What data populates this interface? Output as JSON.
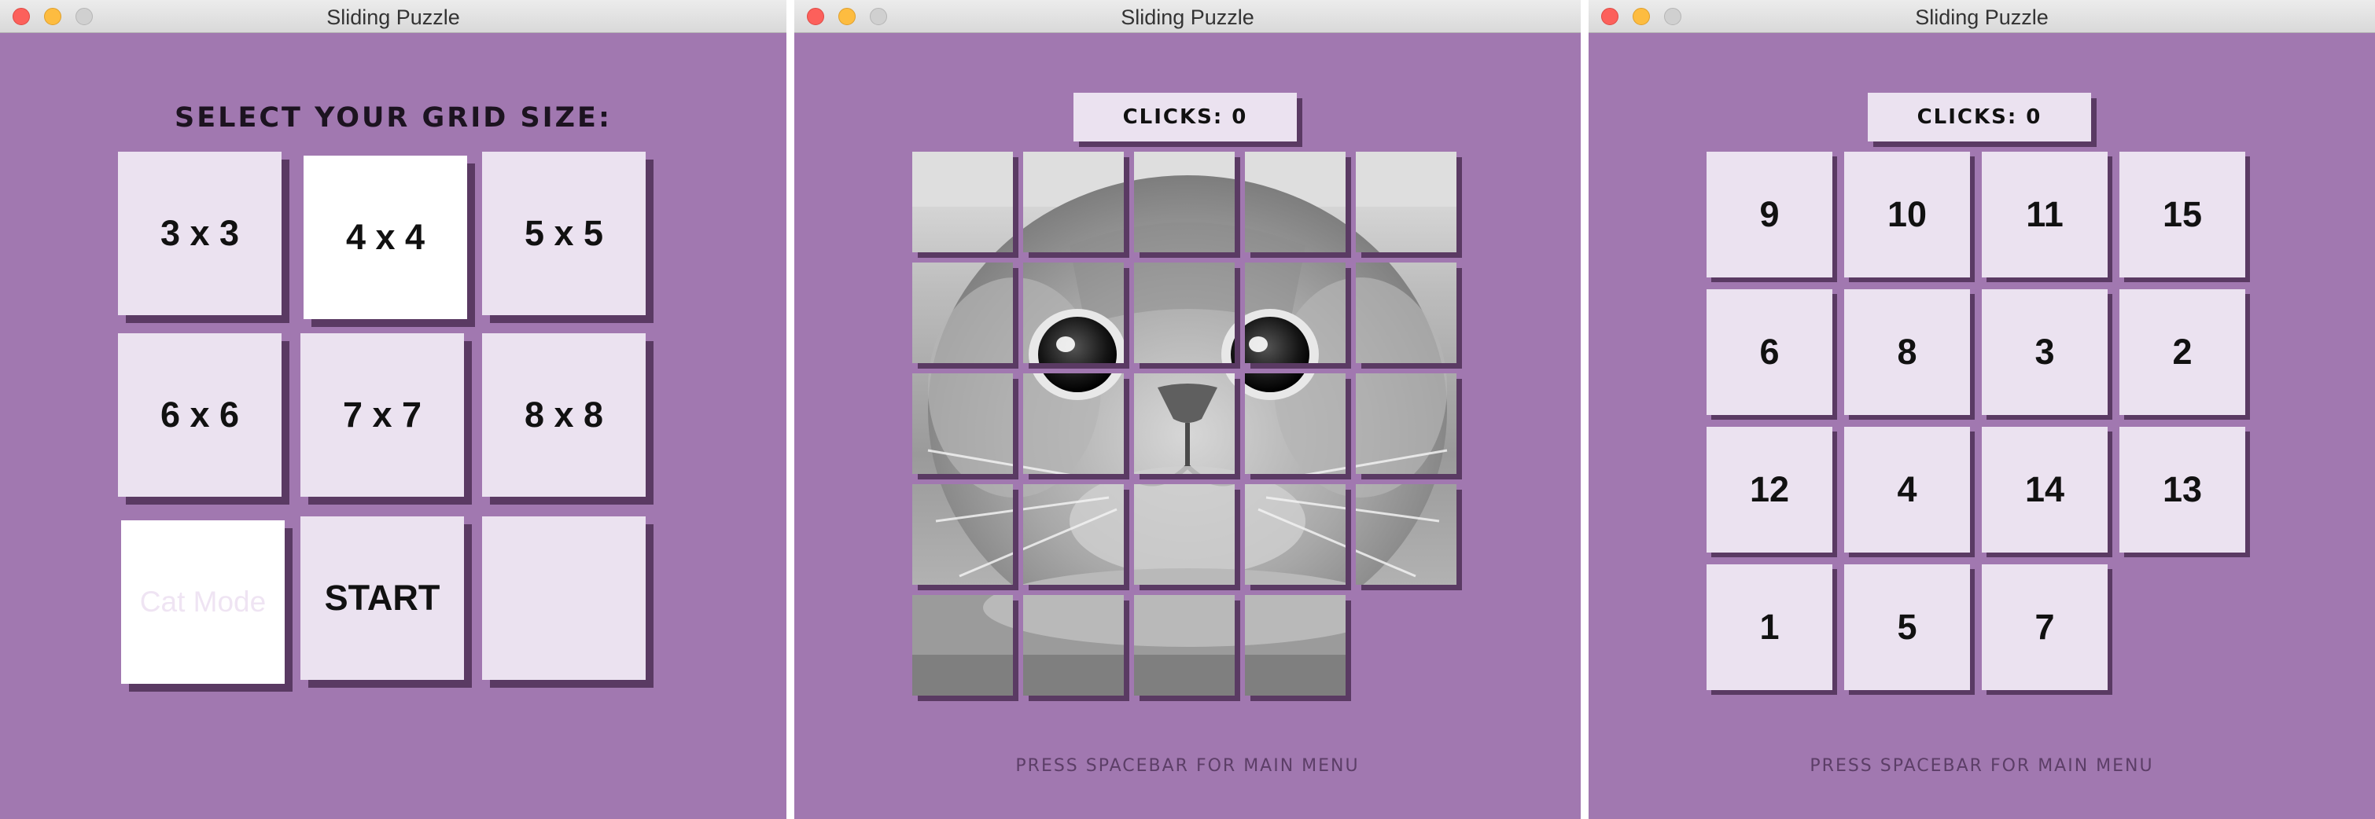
{
  "window_title": "Sliding Puzzle",
  "menu": {
    "heading": "SELECT YOUR GRID SIZE:",
    "options": [
      "3 x 3",
      "4 x 4",
      "5 x 5",
      "6 x 6",
      "7 x 7",
      "8 x 8"
    ],
    "selected_option": "4 x 4",
    "cat_mode_label": "Cat Mode",
    "start_label": "START"
  },
  "cat_game": {
    "clicks_label": "CLICKS: 0",
    "grid_size": 5,
    "footer": "PRESS SPACEBAR FOR MAIN MENU"
  },
  "number_game": {
    "clicks_label": "CLICKS: 0",
    "grid_size": 4,
    "tiles": [
      "9",
      "10",
      "11",
      "15",
      "6",
      "8",
      "3",
      "2",
      "12",
      "4",
      "14",
      "13",
      "1",
      "5",
      "7",
      ""
    ],
    "footer": "PRESS SPACEBAR FOR MAIN MENU"
  },
  "colors": {
    "background": "#a178b0",
    "tile": "#ebe2f0",
    "shadow": "#5a3a63",
    "selected_tile": "#ffffff"
  }
}
